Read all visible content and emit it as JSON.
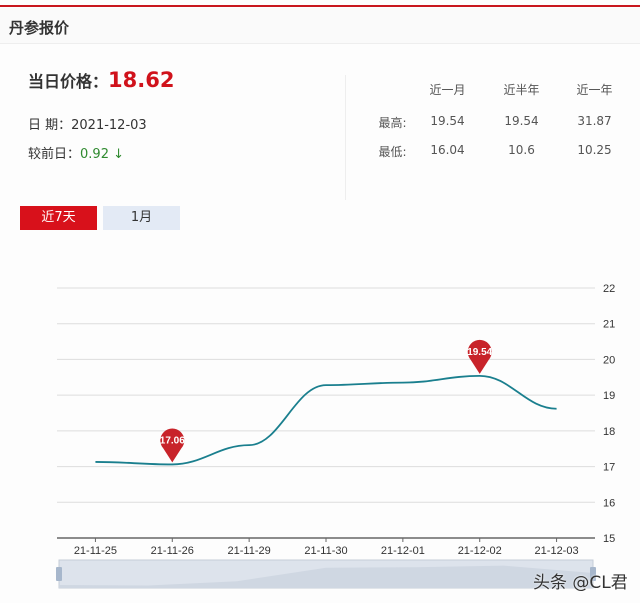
{
  "header": {
    "title": "丹参报价"
  },
  "summary": {
    "price_label": "当日价格：",
    "price": "18.62",
    "date_label": "日 期：",
    "date": "2021-12-03",
    "change_label": "较前日：",
    "change": "0.92 ↓"
  },
  "stats": {
    "columns": [
      "近一月",
      "近半年",
      "近一年"
    ],
    "rows": [
      {
        "label": "最高:",
        "values": [
          "19.54",
          "19.54",
          "31.87"
        ]
      },
      {
        "label": "最低:",
        "values": [
          "16.04",
          "10.6",
          "10.25"
        ]
      }
    ]
  },
  "tabs": [
    {
      "label": "近7天",
      "active": true
    },
    {
      "label": "1月",
      "active": false
    }
  ],
  "chart_data": {
    "type": "line",
    "categories": [
      "21-11-25",
      "21-11-26",
      "21-11-29",
      "21-11-30",
      "21-12-01",
      "21-12-02",
      "21-12-03"
    ],
    "values": [
      17.13,
      17.06,
      17.6,
      19.28,
      19.35,
      19.54,
      18.62
    ],
    "ylim": [
      15,
      22
    ],
    "yticks": [
      15,
      16,
      17,
      18,
      19,
      20,
      21,
      22
    ],
    "markers": [
      {
        "index": 1,
        "label": "17.06"
      },
      {
        "index": 5,
        "label": "19.54"
      }
    ],
    "line_color": "#1a7f8e",
    "marker_color": "#c8232a",
    "grid": true
  },
  "watermark": "头条 @CL君"
}
